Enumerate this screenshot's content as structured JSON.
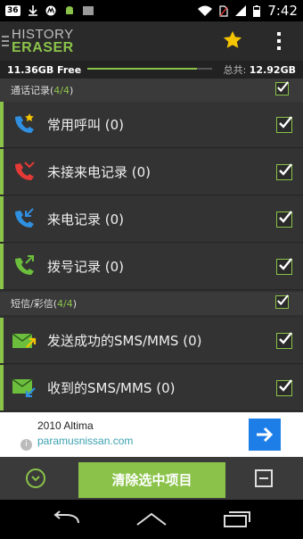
{
  "status_bar": {
    "notification_count": "36",
    "time": "7:42",
    "icons": [
      "download-icon",
      "motorola-icon",
      "android-icon",
      "barcode-icon",
      "wifi-icon",
      "no-sim-icon",
      "signal-icon",
      "battery-icon"
    ]
  },
  "header": {
    "logo_line1": "HISTORY",
    "logo_line2": "ERASER"
  },
  "storage": {
    "free_label": "11.36GB Free",
    "used_fraction": 0.88,
    "total_prefix": "总共: ",
    "total_value": "12.92GB"
  },
  "sections": [
    {
      "title": "通话记录(",
      "count": "4/4",
      "close": ")"
    },
    {
      "title": "短信/彩信(",
      "count": "4/4",
      "close": ")"
    }
  ],
  "call_items": [
    {
      "label": "常用呼叫 (0)",
      "icon": "favorite-call-icon"
    },
    {
      "label": "未接来电记录 (0)",
      "icon": "missed-call-icon"
    },
    {
      "label": "来电记录 (0)",
      "icon": "incoming-call-icon"
    },
    {
      "label": "拨号记录 (0)",
      "icon": "outgoing-call-icon"
    }
  ],
  "sms_items": [
    {
      "label": "发送成功的SMS/MMS (0)",
      "icon": "sent-sms-icon"
    },
    {
      "label": "收到的SMS/MMS (0)",
      "icon": "received-sms-icon"
    }
  ],
  "ad": {
    "title": "2010 Altima",
    "url": "paramusnissan.com",
    "info": "i"
  },
  "actions": {
    "clear_label": "清除选中项目"
  },
  "colors": {
    "accent": "#8bc34a",
    "ad_button": "#1e7ee8"
  }
}
